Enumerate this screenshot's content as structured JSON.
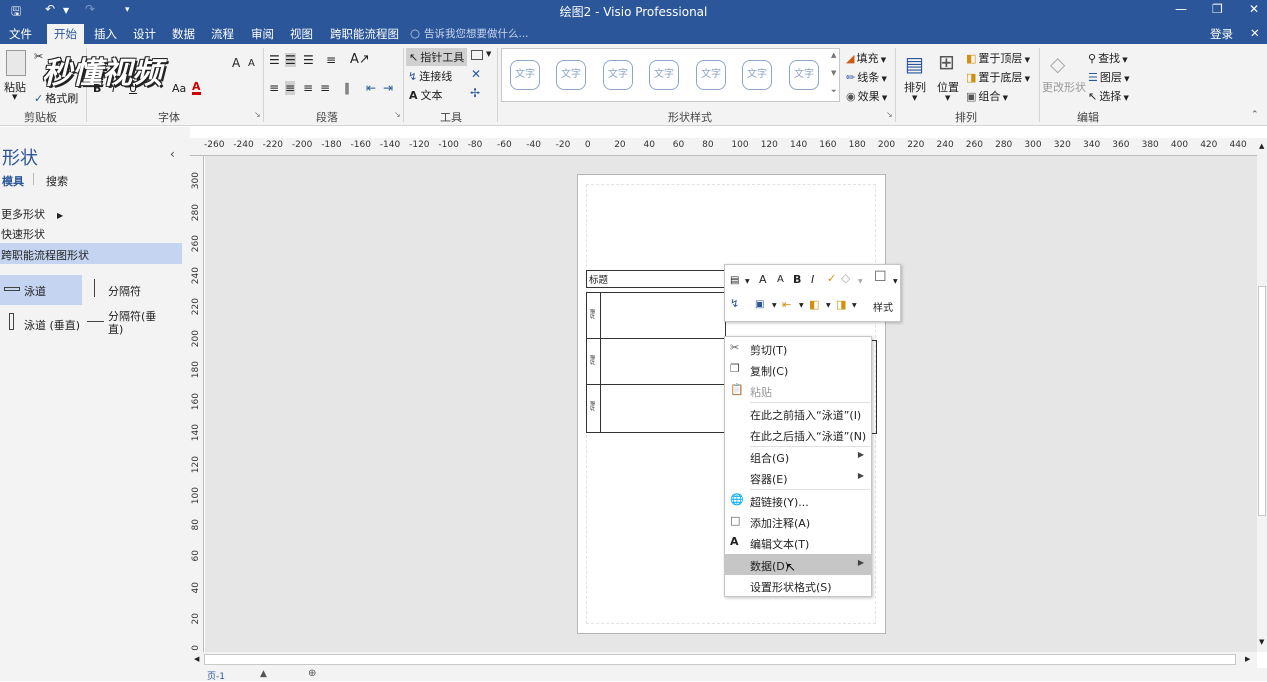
{
  "window": {
    "title": "绘图2 - Visio Professional",
    "login": "登录"
  },
  "quick_access": {
    "save": "save-icon",
    "undo": "undo-icon",
    "redo": "redo-icon"
  },
  "menu": {
    "items": [
      "文件",
      "开始",
      "插入",
      "设计",
      "数据",
      "流程",
      "审阅",
      "视图",
      "跨职能流程图"
    ],
    "active": "开始",
    "tell_me": "告诉我您想要做什么..."
  },
  "watermark": "秒懂视频",
  "ribbon": {
    "clipboard": {
      "label": "剪贴板",
      "paste": "粘贴",
      "format_painter": "格式刷"
    },
    "font": {
      "label": "字体"
    },
    "paragraph": {
      "label": "段落"
    },
    "tools": {
      "label": "工具",
      "pointer": "指针工具",
      "connector": "连接线",
      "text": "文本"
    },
    "shape_styles": {
      "label": "形状样式",
      "style_text": "文字",
      "fill": "填充",
      "line": "线条",
      "effect": "效果"
    },
    "arrange": {
      "label": "排列",
      "arrange": "排列",
      "position": "位置",
      "bring_front": "置于顶层",
      "send_back": "置于底层",
      "group": "组合"
    },
    "edit": {
      "label": "编辑",
      "change_shape": "更改形状",
      "find": "查找",
      "layers": "图层",
      "select": "选择"
    }
  },
  "shapes_panel": {
    "title": "形状",
    "tab_stencils": "模具",
    "tab_search": "搜索",
    "more_shapes": "更多形状",
    "quick_shapes": "快速形状",
    "category": "跨职能流程图形状",
    "items": [
      "泳道",
      "分隔符",
      "泳道 (垂直)",
      "分隔符(垂直)"
    ]
  },
  "ruler": {
    "top": [
      "-260",
      "-240",
      "-220",
      "-200",
      "-180",
      "-160",
      "-140",
      "-120",
      "-100",
      "-80",
      "-60",
      "-40",
      "-20",
      "0",
      "20",
      "40",
      "60",
      "80",
      "100",
      "120",
      "140",
      "160",
      "180",
      "200",
      "220",
      "240",
      "260",
      "280",
      "300",
      "320",
      "340",
      "360",
      "380",
      "400",
      "420",
      "440"
    ],
    "left": [
      "300",
      "280",
      "260",
      "240",
      "220",
      "200",
      "180",
      "160",
      "140",
      "120",
      "100",
      "80",
      "60",
      "40",
      "20",
      "0"
    ]
  },
  "diagram": {
    "title": "标题",
    "lane_labels": [
      "功能",
      "功能",
      "功能"
    ]
  },
  "mini_toolbar": {
    "style_label": "样式"
  },
  "context_menu": [
    {
      "label": "剪切(T)",
      "icon": "scissors-icon"
    },
    {
      "label": "复制(C)",
      "icon": "copy-icon"
    },
    {
      "label": "粘贴",
      "icon": "paste-icon",
      "disabled": true
    },
    {
      "label": "在此之前插入“泳道”(I)"
    },
    {
      "label": "在此之后插入“泳道”(N)"
    },
    {
      "label": "组合(G)",
      "submenu": true
    },
    {
      "label": "容器(E)",
      "submenu": true
    },
    {
      "label": "超链接(Y)...",
      "icon": "globe-link-icon"
    },
    {
      "label": "添加注释(A)",
      "icon": "comment-icon"
    },
    {
      "label": "编辑文本(T)",
      "icon": "text-a-icon"
    },
    {
      "label": "数据(D)",
      "submenu": true,
      "highlighted": true
    },
    {
      "label": "设置形状格式(S)"
    }
  ],
  "status": {
    "page": "页-1"
  },
  "colors": {
    "accent": "#2b579a",
    "selected": "#c5d4f0",
    "highlight": "#c6c6c6"
  }
}
